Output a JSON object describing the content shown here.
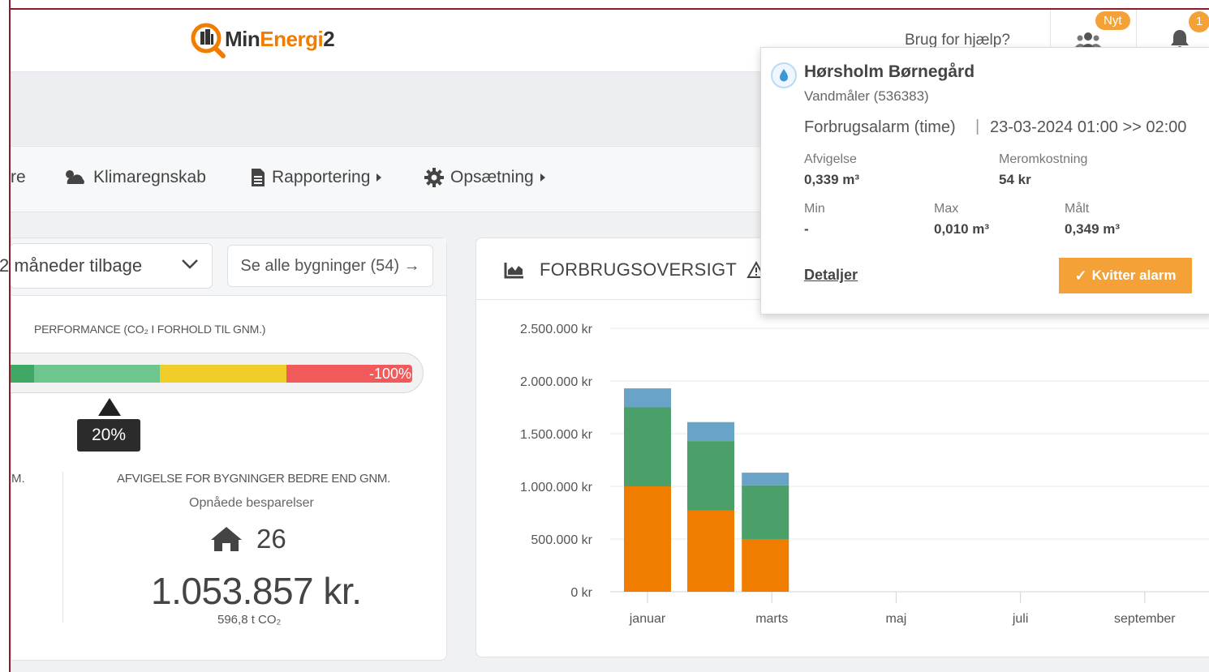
{
  "app": {
    "logo_part1": "Min",
    "logo_part2": "Energi",
    "logo_part3": "2"
  },
  "header": {
    "help_label": "Brug for hjælp?",
    "users_badge": "Nyt",
    "notification_count": "1"
  },
  "nav": {
    "items": [
      {
        "label": "re"
      },
      {
        "label": "Klimaregnskab"
      },
      {
        "label": "Rapportering"
      },
      {
        "label": "Opsætning"
      }
    ]
  },
  "left_panel": {
    "period_value": "2 måneder tilbage",
    "see_all_label": "Se alle bygninger (54) →",
    "performance_title": "PERFORMANCE (CO₂ I FORHOLD TIL GNM.)",
    "bar_end_label": "-100%",
    "marker_value": "20%",
    "left_stat_title_fragment": "M.",
    "afvigelse_title": "AFVIGELSE FOR BYGNINGER BEDRE END GNM.",
    "afvigelse_subtitle": "Opnåede besparelser",
    "building_count": "26",
    "savings_amount": "1.053.857 kr.",
    "co2_amount": "596,8 t CO₂"
  },
  "overview": {
    "title": "FORBRUGSOVERSIGT",
    "warning_icon": "warning-triangle-icon"
  },
  "chart_data": {
    "type": "bar",
    "stacked": true,
    "x_tick_labels": [
      "januar",
      "marts",
      "maj",
      "juli",
      "september"
    ],
    "categories": [
      "januar",
      "februar",
      "marts"
    ],
    "y_ticks": [
      "0 kr",
      "500.000 kr",
      "1.000.000 kr",
      "1.500.000 kr",
      "2.000.000 kr",
      "2.500.000 kr"
    ],
    "ylim": [
      0,
      2500000
    ],
    "series": [
      {
        "color": "#f07d00",
        "values": [
          1000000,
          770000,
          500000
        ]
      },
      {
        "color": "#4aa068",
        "values": [
          750000,
          660000,
          510000
        ]
      },
      {
        "color": "#6aa3c8",
        "values": [
          180000,
          180000,
          120000
        ]
      }
    ],
    "grid": true
  },
  "alarm_popup": {
    "building": "Hørsholm Børnegård",
    "meter": "Vandmåler (536383)",
    "alarm_type": "Forbrugsalarm (time)",
    "separator": "|",
    "period": "23-03-2024 01:00 >> 02:00",
    "afvigelse_label": "Afvigelse",
    "afvigelse_value": "0,339 m³",
    "meromkostning_label": "Meromkostning",
    "meromkostning_value": "54 kr",
    "min_label": "Min",
    "min_value": "-",
    "max_label": "Max",
    "max_value": "0,010 m³",
    "maalt_label": "Målt",
    "maalt_value": "0,349 m³",
    "details_link": "Detaljer",
    "ack_button": "Kvitter alarm"
  },
  "colors": {
    "accent": "#f4a237",
    "brand_orange": "#f07d00",
    "green": "#4aa068",
    "blue": "#6aa3c8",
    "bar_red": "#f05a5a",
    "bar_yellow": "#f1cd2a",
    "bar_green": "#6dc68e"
  }
}
